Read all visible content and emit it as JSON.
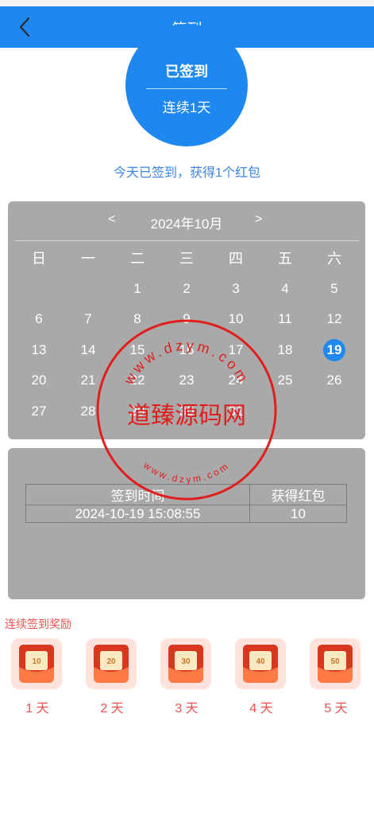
{
  "header": {
    "title": "签到",
    "back_icon": "chevron-left-icon"
  },
  "badge": {
    "status": "已签到",
    "streak": "连续1天"
  },
  "message": "今天已签到，获得1个红包",
  "calendar": {
    "prev": "<",
    "month": "2024年10月",
    "next": ">",
    "weekdays": [
      "日",
      "一",
      "二",
      "三",
      "四",
      "五",
      "六"
    ],
    "leading_blanks": 2,
    "days": [
      "1",
      "2",
      "3",
      "4",
      "5",
      "6",
      "7",
      "8",
      "9",
      "10",
      "11",
      "12",
      "13",
      "14",
      "15",
      "16",
      "17",
      "18",
      "19",
      "20",
      "21",
      "22",
      "23",
      "24",
      "25",
      "26",
      "27",
      "28",
      "29",
      "30",
      "31"
    ],
    "today": "19"
  },
  "records": {
    "headers": [
      "签到时间",
      "获得红包"
    ],
    "rows": [
      [
        "2024-10-19 15:08:55",
        "10"
      ]
    ]
  },
  "rewards": {
    "title": "连续签到奖励",
    "items": [
      {
        "amount": "10",
        "label": "1 天"
      },
      {
        "amount": "20",
        "label": "2 天"
      },
      {
        "amount": "30",
        "label": "3 天"
      },
      {
        "amount": "40",
        "label": "4 天"
      },
      {
        "amount": "50",
        "label": "5 天"
      }
    ]
  },
  "watermark": {
    "text": "道臻源码网",
    "ring_top": "www.dzym.com",
    "ring_bottom": "www.dzym.com"
  },
  "colors": {
    "accent": "#1e88f0",
    "message": "#3b86e6",
    "reward": "#f0524f",
    "panel": "#a9a9a9",
    "stamp": "#e21d1d"
  }
}
